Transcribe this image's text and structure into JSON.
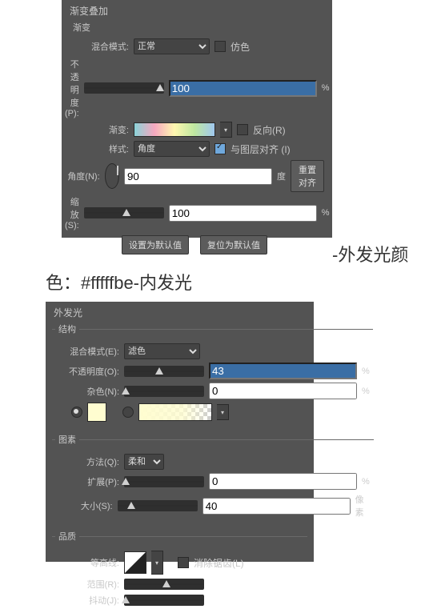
{
  "panel1": {
    "title": "渐变叠加",
    "sub": "渐变",
    "blendLabel": "混合模式:",
    "blendValue": "正常",
    "ditherLabel": "仿色",
    "opacityLabel": "不透明度(P):",
    "opacityValue": "100",
    "opacityUnit": "%",
    "gradientLabel": "渐变:",
    "reverseLabel": "反向(R)",
    "styleLabel": "样式:",
    "styleValue": "角度",
    "alignLabel": "与图层对齐 (I)",
    "angleLabel": "角度(N):",
    "angleValue": "90",
    "angleUnit": "度",
    "resetAlign": "重置对齐",
    "scaleLabel": "缩放(S):",
    "scaleValue": "100",
    "scaleUnit": "%",
    "setDefault": "设置为默认值",
    "resetDefault": "复位为默认值"
  },
  "caption": {
    "part1": "-外发光颜",
    "part2": "色：#fffffbe-内发光"
  },
  "panel2": {
    "title": "外发光",
    "structTitle": "结构",
    "blendLabel": "混合模式(E):",
    "blendValue": "滤色",
    "opacityLabel": "不透明度(O):",
    "opacityValue": "43",
    "opacityUnit": "%",
    "noiseLabel": "杂色(N):",
    "noiseValue": "0",
    "noiseUnit": "%",
    "elementsTitle": "图素",
    "methodLabel": "方法(Q):",
    "methodValue": "柔和",
    "spreadLabel": "扩展(P):",
    "spreadValue": "0",
    "spreadUnit": "%",
    "sizeLabel": "大小(S):",
    "sizeValue": "40",
    "sizeUnit": "像素",
    "qualityTitle": "品质",
    "contourLabel": "等高线:",
    "antiAliasLabel": "消除锯齿(L)",
    "rangeLabel": "范围(R):",
    "jitterLabel": "抖动(J):"
  }
}
